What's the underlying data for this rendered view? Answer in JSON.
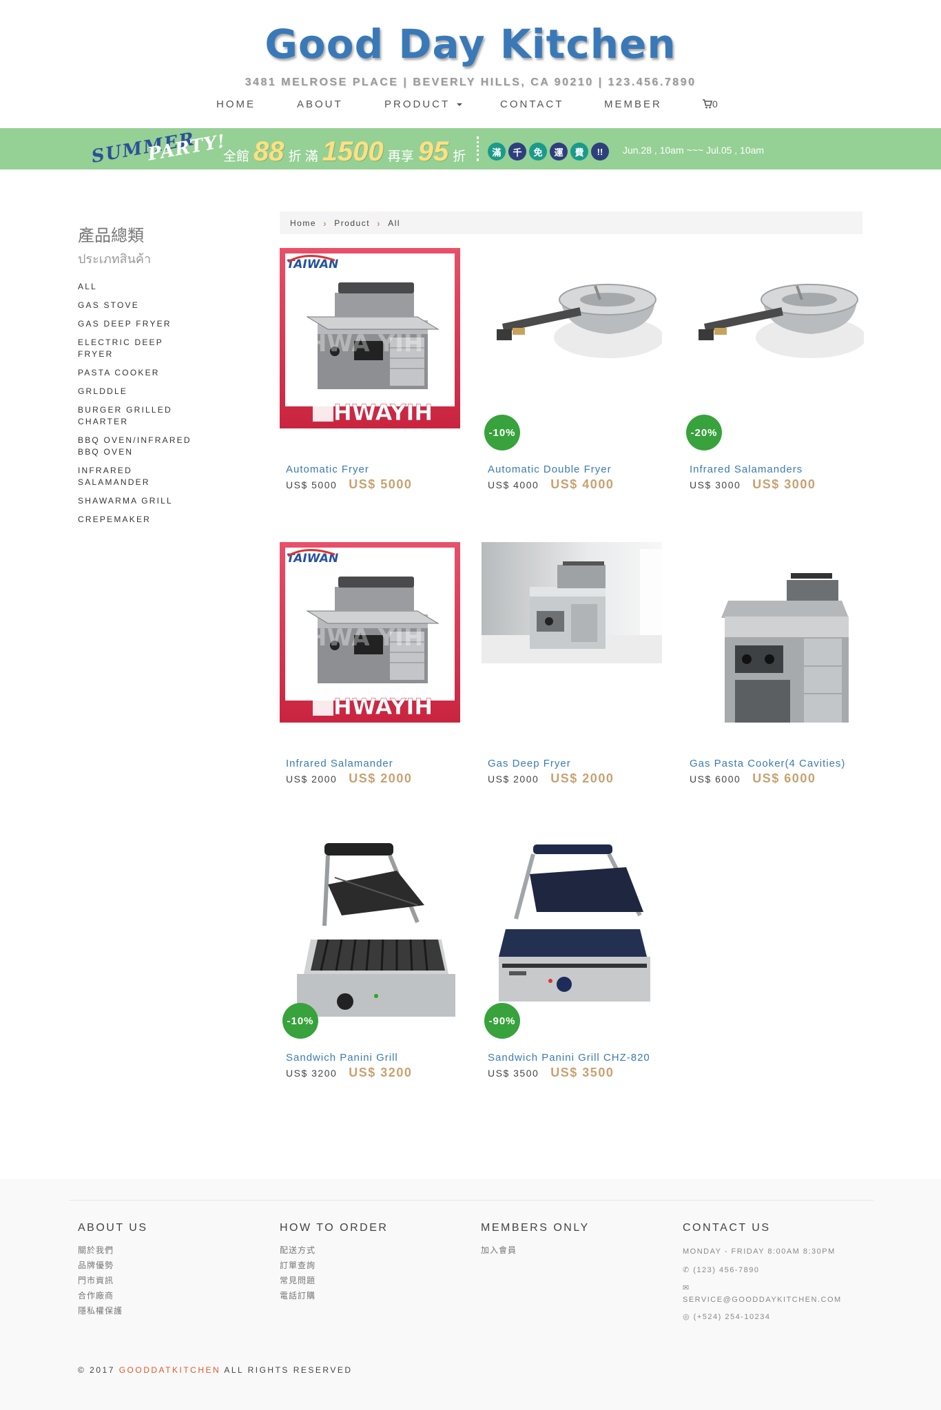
{
  "site": {
    "title": "Good Day Kitchen",
    "address": "3481 MELROSE PLACE | BEVERLY HILLS, CA 90210 | 123.456.7890"
  },
  "nav": {
    "home": "HOME",
    "about": "ABOUT",
    "product": "PRODUCT",
    "contact": "CONTACT",
    "member": "MEMBER",
    "cart_count": "0"
  },
  "banner": {
    "summer": "SUMMER",
    "party": "PARTY!",
    "text1": "全館",
    "big1": "88",
    "text2": "折 滿",
    "big2": "1500",
    "text3": "再享",
    "big3": "95",
    "text4": "折",
    "badges": [
      "滿",
      "千",
      "免",
      "運",
      "費",
      "!!"
    ],
    "badge_colors": [
      "#1b9a8a",
      "#2d3f7c",
      "#1b9a8a",
      "#2d3f7c",
      "#1b9a8a",
      "#2d3f7c"
    ],
    "dates": "Jun.28 , 10am ~~~ Jul.05 , 10am"
  },
  "sidebar": {
    "title": "產品總類",
    "subtitle": "ประเภทสินค้า",
    "items": [
      "ALL",
      "GAS STOVE",
      "GAS DEEP FRYER",
      "ELECTRIC DEEP FRYER",
      "PASTA COOKER",
      "GRLDDLE",
      "BURGER GRILLED CHARTER",
      "BBQ OVEN/INFRARED BBQ OVEN",
      "INFRARED SALAMANDER",
      "SHAWARMA GRILL",
      "CREPEMAKER"
    ]
  },
  "breadcrumb": {
    "home": "Home",
    "product": "Product",
    "all": "All"
  },
  "products": [
    {
      "name": "Automatic Fryer",
      "old_price": "US$ 5000",
      "price": "US$ 5000",
      "discount": "",
      "image": "hwayih-grill-icon"
    },
    {
      "name": "Automatic Double Fryer",
      "old_price": "US$ 4000",
      "price": "US$ 4000",
      "discount": "-10%",
      "image": "gas-burner-icon"
    },
    {
      "name": "Infrared Salamanders",
      "old_price": "US$ 3000",
      "price": "US$ 3000",
      "discount": "-20%",
      "image": "gas-burner-icon"
    },
    {
      "name": "Infrared Salamander",
      "old_price": "US$ 2000",
      "price": "US$ 2000",
      "discount": "",
      "image": "hwayih-grill-icon"
    },
    {
      "name": "Gas Deep Fryer",
      "old_price": "US$ 2000",
      "price": "US$ 2000",
      "discount": "",
      "image": "deep-fryer-photo-icon"
    },
    {
      "name": "Gas Pasta Cooker(4 Cavities)",
      "old_price": "US$ 6000",
      "price": "US$ 6000",
      "discount": "",
      "image": "pasta-cooker-icon"
    },
    {
      "name": "Sandwich Panini Grill",
      "old_price": "US$ 3200",
      "price": "US$ 3200",
      "discount": "-10%",
      "image": "panini-grill-icon"
    },
    {
      "name": "Sandwich Panini Grill CHZ-820",
      "old_price": "US$ 3500",
      "price": "US$ 3500",
      "discount": "-90%",
      "image": "panini-grill-flat-icon"
    }
  ],
  "image_text": {
    "taiwan": "TAIWAN",
    "hwayih": "HWAYIH",
    "watermark": "HWA YIH"
  },
  "footer": {
    "about": {
      "title": "ABOUT US",
      "links": [
        "關於我們",
        "品牌優勢",
        "門市資訊",
        "合作廠商",
        "隱私權保護"
      ]
    },
    "order": {
      "title": "HOW TO ORDER",
      "links": [
        "配送方式",
        "訂單查詢",
        "常見問題",
        "電話訂購"
      ]
    },
    "members": {
      "title": "MEMBERS ONLY",
      "links": [
        "加入會員"
      ]
    },
    "contact": {
      "title": "CONTACT US",
      "hours": "MONDAY - FRIDAY 8:00AM 8:30PM",
      "phone": "(123) 456-7890",
      "email": "SERVICE@GOODDAYKITCHEN.COM",
      "whatsapp": "(+524) 254-10234"
    },
    "copyright_prefix": "© 2017",
    "copyright_brand": "GOODDATKITCHEN",
    "copyright_suffix": "ALL RIGHTS RESERVED"
  }
}
